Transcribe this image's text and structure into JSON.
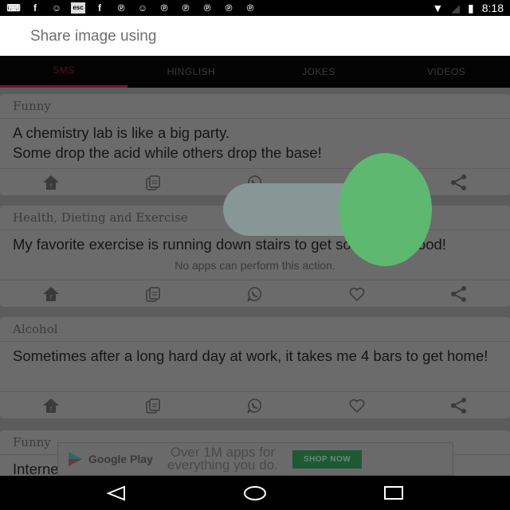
{
  "status_bar": {
    "time": "8:18",
    "notification_icons": [
      "keyboard-icon",
      "facebook-icon",
      "cat-icon",
      "esc-icon",
      "facebook-icon",
      "pinterest-icon",
      "cat-icon",
      "pinterest-icon",
      "pinterest-icon",
      "pinterest-icon",
      "pinterest-icon",
      "pinterest-icon"
    ]
  },
  "share_sheet": {
    "title": "Share image using",
    "empty_message": "No apps can perform this action."
  },
  "tabs": [
    {
      "label": "SMS",
      "active": true
    },
    {
      "label": "HINGLISH"
    },
    {
      "label": "JOKES"
    },
    {
      "label": "VIDEOS"
    }
  ],
  "cards": [
    {
      "category": "Funny",
      "text": "A chemistry lab is like a big party.\nSome drop the acid while others drop the base!"
    },
    {
      "category": "Health, Dieting and Exercise",
      "text": "My favorite exercise is running down stairs to get some more food!"
    },
    {
      "category": "Alcohol",
      "text": "Sometimes after a long hard day at work, it takes me 4 bars to get home!"
    },
    {
      "category": "Funny",
      "text": "Internet"
    }
  ],
  "ad": {
    "brand": "Google Play",
    "line1": "Over 1M apps for",
    "line2": "everything you do.",
    "cta": "SHOP NOW"
  },
  "colors": {
    "accent": "#7a1430",
    "green": "#5fb870"
  }
}
